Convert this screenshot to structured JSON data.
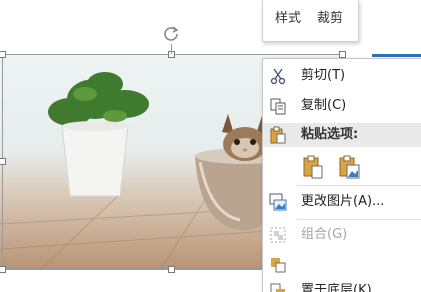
{
  "mini_toolbar": {
    "style_label": "样式",
    "crop_label": "裁剪"
  },
  "context_menu": {
    "items": [
      {
        "label": "剪切(T)",
        "icon": "scissors-icon",
        "enabled": true
      },
      {
        "label": "复制(C)",
        "icon": "copy-icon",
        "enabled": true
      }
    ],
    "paste_header": {
      "label": "粘贴选项:",
      "icon": "clipboard-icon"
    },
    "paste_options": [
      {
        "icon": "paste-keep-format-icon"
      },
      {
        "icon": "paste-picture-icon"
      }
    ],
    "change_picture": {
      "label": "更改图片(A)...",
      "icon": "change-picture-icon"
    },
    "group": {
      "label": "组合(G)",
      "icon": "group-icon",
      "enabled": false
    },
    "bring_forward": {
      "label": "",
      "icon": "bring-forward-icon"
    },
    "send_backward": {
      "label": "置于底层(K)",
      "icon": "send-backward-icon"
    }
  },
  "colors": {
    "accent": "#2f6fb3",
    "menu_header_bg": "#e9e9e9",
    "disabled_text": "#a6a6a6"
  }
}
